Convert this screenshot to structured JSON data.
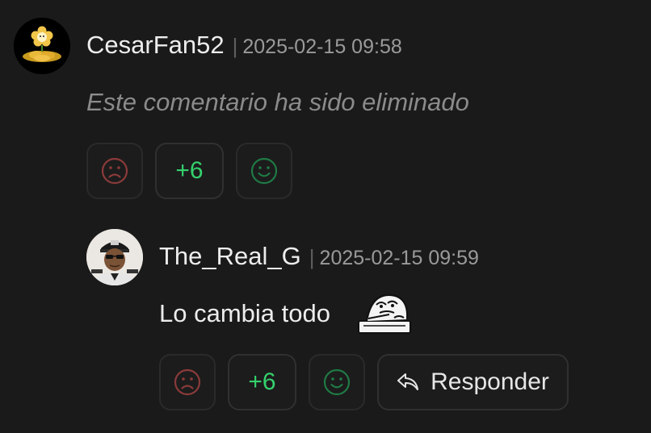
{
  "comments": [
    {
      "author": "CesarFan52",
      "timestamp": "2025-02-15 09:58",
      "text": "Este comentario ha sido eliminado",
      "deleted": true,
      "score": "+6",
      "avatar": "golden-flower-icon"
    },
    {
      "author": "The_Real_G",
      "timestamp": "2025-02-15 09:59",
      "text": "Lo cambia todo",
      "deleted": false,
      "score": "+6",
      "avatar": "sunglasses-man-avatar",
      "reply_label": "Responder"
    }
  ],
  "separator": "|",
  "icons": {
    "dislike": "sad-face-icon",
    "like": "smile-face-icon",
    "reply": "reply-arrow-icon",
    "emote": "rage-face-reading-emote"
  },
  "colors": {
    "background": "#1a1a1a",
    "score": "#34d16d",
    "dislike": "#8b3a3a",
    "like": "#1f7a45"
  }
}
